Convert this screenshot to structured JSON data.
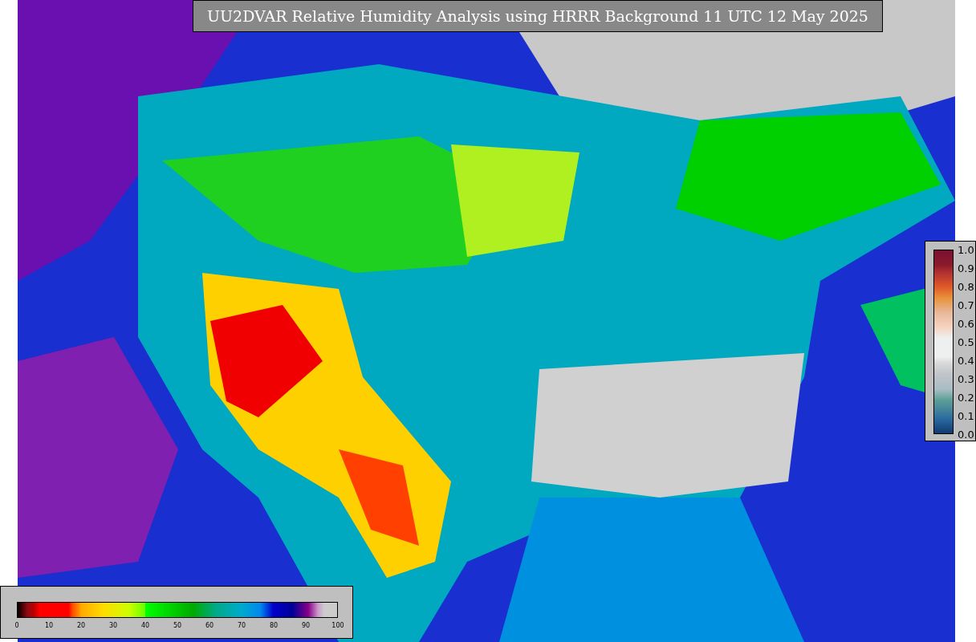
{
  "title": "UU2DVAR Relative Humidity Analysis using HRRR Background 11 UTC 12 May 2025",
  "humidity_legend": {
    "ticks": [
      "0",
      "10",
      "20",
      "30",
      "40",
      "50",
      "60",
      "70",
      "80",
      "90",
      "100"
    ]
  },
  "uncertainty_legend": {
    "ticks": [
      "1.0",
      "0.9",
      "0.8",
      "0.7",
      "0.6",
      "0.5",
      "0.4",
      "0.3",
      "0.2",
      "0.1",
      "0.0"
    ]
  }
}
